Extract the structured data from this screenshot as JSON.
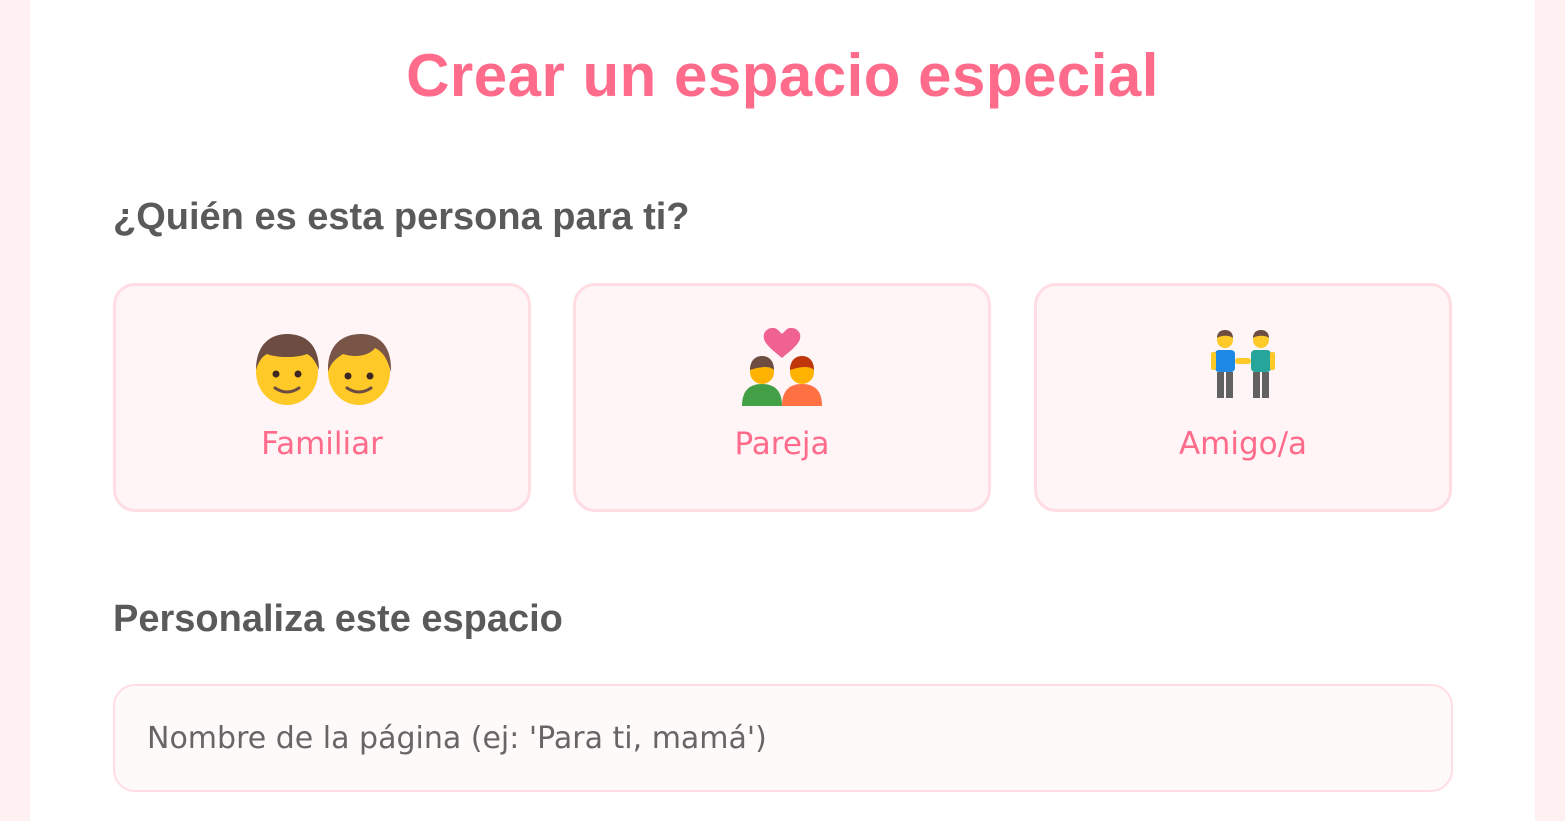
{
  "page": {
    "title": "Crear un espacio especial"
  },
  "relationship": {
    "heading": "¿Quién es esta persona para ti?",
    "options": [
      {
        "label": "Familiar",
        "icon": "family-father-son-icon"
      },
      {
        "label": "Pareja",
        "icon": "couple-with-heart-icon"
      },
      {
        "label": "Amigo/a",
        "icon": "two-friends-holding-hands-icon"
      }
    ]
  },
  "personalize": {
    "heading": "Personaliza este espacio",
    "name_input": {
      "value": "",
      "placeholder": "Nombre de la página (ej: 'Para ti, mamá')"
    }
  },
  "colors": {
    "accent": "#ff6b8b",
    "heading_text": "#5a5a5a",
    "option_bg": "#fff5f6",
    "option_border": "#ffdde3",
    "page_bg": "#fff0f2"
  }
}
